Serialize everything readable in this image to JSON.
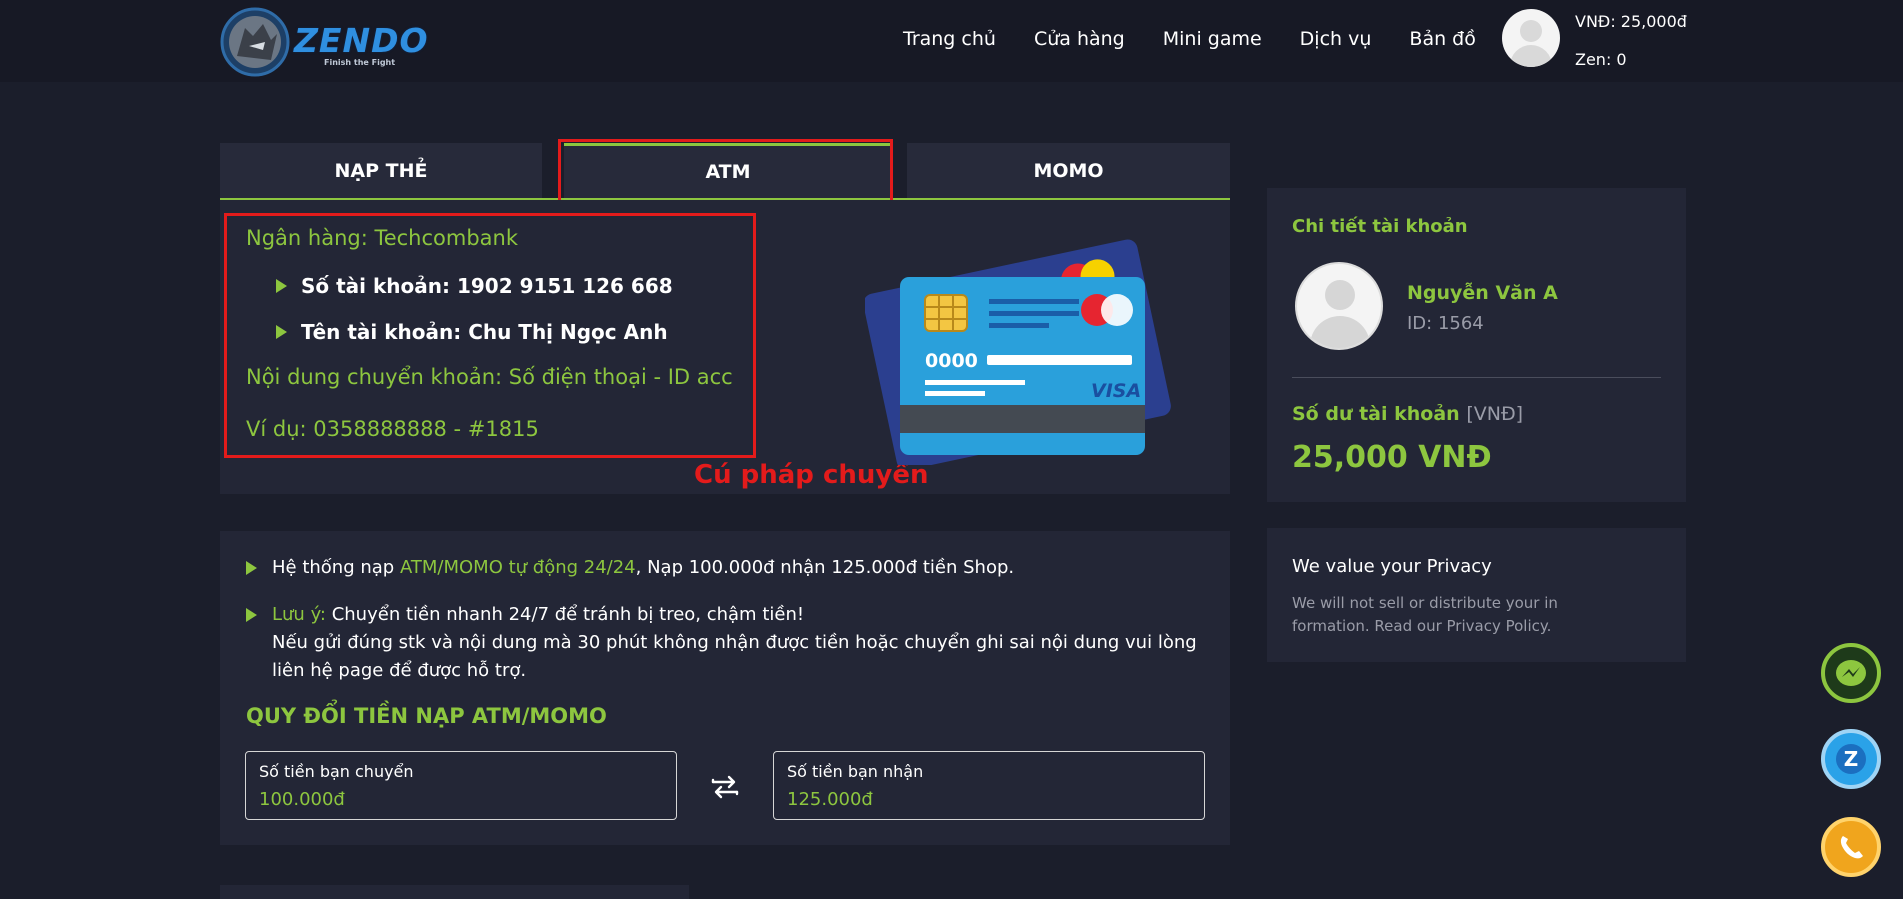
{
  "header": {
    "logo_text": "ZENDO",
    "logo_tagline": "Finish the Fight",
    "nav": [
      "Trang chủ",
      "Cửa hàng",
      "Mini game",
      "Dịch vụ",
      "Bản đồ"
    ],
    "balance": "VNĐ: 25,000đ",
    "zen": "Zen: 0"
  },
  "tabs": {
    "napthe": "NẠP THẺ",
    "atm": "ATM",
    "momo": "MOMO",
    "active": "ATM"
  },
  "bank": {
    "bank_name": "Ngân hàng: Techcombank",
    "account_number": "Số tài khoản: 1902 9151 126 668",
    "account_name": "Tên tài khoản: Chu Thị Ngọc Anh",
    "transfer_content": "Nội dung chuyển khoản: Số điện thoại - ID acc",
    "example": "Ví dụ: 0358888888 - #1815",
    "annotation": "Cú pháp chuyển",
    "card_number_text": "0000",
    "card_brand": "VISA"
  },
  "notes": {
    "note1_prefix": "Hệ thống nạp ",
    "note1_highlight": "ATM/MOMO tự động 24/24",
    "note1_suffix": ", Nạp 100.000đ nhận 125.000đ tiền Shop.",
    "note2_highlight": "Lưu ý:",
    "note2_line1": " Chuyển tiền nhanh 24/7 để tránh bị treo, chậm tiền!",
    "note2_line2": "Nếu gửi đúng stk và nội dung mà 30 phút không nhận được tiền hoặc chuyển ghi sai nội dung vui lòng liên hệ page để được hỗ trợ."
  },
  "converter": {
    "title": "QUY ĐỔI TIỀN NẠP ATM/MOMO",
    "send_label": "Số tiền bạn chuyển",
    "send_value": "100.000đ",
    "receive_label": "Số tiền bạn nhận",
    "receive_value": "125.000đ"
  },
  "account": {
    "title": "Chi tiết tài khoản",
    "name": "Nguyễn Văn A",
    "id": "ID: 1564",
    "balance_label": "Số dư tài khoản",
    "balance_unit": "[VNĐ]",
    "balance_value": "25,000 VNĐ"
  },
  "privacy": {
    "title": "We value your Privacy",
    "text": "We will not sell or distribute your in formation. Read our Privacy Policy."
  },
  "colors": {
    "accent": "#8dc63f",
    "highlight_red": "#e31b1b",
    "background": "#1b1e2b",
    "panel": "#232636"
  },
  "icons": [
    "messenger-icon",
    "zalo-icon",
    "phone-icon",
    "swap-icon"
  ]
}
